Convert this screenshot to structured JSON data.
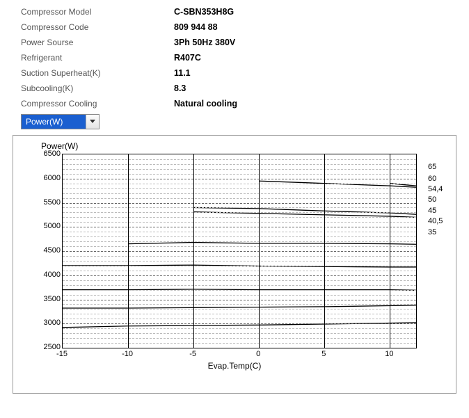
{
  "specs": [
    {
      "label": "Compressor Model",
      "value": "C-SBN353H8G"
    },
    {
      "label": "Compressor Code",
      "value": "809 944 88"
    },
    {
      "label": "Power Sourse",
      "value": "3Ph  50Hz  380V"
    },
    {
      "label": "Refrigerant",
      "value": "R407C"
    },
    {
      "label": "Suction Superheat(K)",
      "value": "11.1"
    },
    {
      "label": "Subcooling(K)",
      "value": "8.3"
    },
    {
      "label": "Compressor Cooling",
      "value": "Natural cooling"
    }
  ],
  "dropdown": {
    "selected": "Power(W)"
  },
  "chart_data": {
    "type": "line",
    "title": "Power(W)",
    "xlabel": "Evap.Temp(C)",
    "ylabel": "Power(W)",
    "xlim": [
      -15,
      12
    ],
    "ylim": [
      2500,
      6500
    ],
    "x": [
      -15,
      -10,
      -5,
      0,
      5,
      10,
      12
    ],
    "xticks": [
      -15,
      -10,
      -5,
      0,
      5,
      10
    ],
    "yticks": [
      2500,
      3000,
      3500,
      4000,
      4500,
      5000,
      5500,
      6000,
      6500
    ],
    "series": [
      {
        "name": "65",
        "values": [
          null,
          null,
          null,
          null,
          null,
          5900,
          5850
        ]
      },
      {
        "name": "60",
        "values": [
          null,
          null,
          null,
          5950,
          5900,
          5850,
          5820
        ]
      },
      {
        "name": "54.4",
        "values": [
          null,
          null,
          5400,
          5380,
          5330,
          5290,
          5260
        ]
      },
      {
        "name": "50",
        "values": [
          null,
          null,
          5310,
          5280,
          5250,
          5220,
          5200
        ]
      },
      {
        "name": "45",
        "values": [
          null,
          4650,
          4680,
          4660,
          4660,
          4650,
          4640
        ]
      },
      {
        "name": "40.5",
        "values": [
          4200,
          4200,
          4210,
          4190,
          4180,
          4170,
          4170
        ]
      },
      {
        "name": "35",
        "values": [
          3700,
          3700,
          3710,
          3700,
          3700,
          3700,
          3690
        ]
      }
    ],
    "extra_series": [
      {
        "name": "s8",
        "values": [
          3320,
          3320,
          3330,
          3340,
          3350,
          3370,
          3380
        ]
      },
      {
        "name": "s9",
        "values": [
          2920,
          2950,
          2960,
          2970,
          2990,
          3010,
          3020
        ]
      }
    ],
    "right_labels": [
      {
        "text": "65",
        "y": 6220
      },
      {
        "text": "60",
        "y": 5980
      },
      {
        "text": "54,4",
        "y": 5760
      },
      {
        "text": "50",
        "y": 5550
      },
      {
        "text": "45",
        "y": 5320
      },
      {
        "text": "40,5",
        "y": 5100
      },
      {
        "text": "35",
        "y": 4870
      }
    ]
  }
}
